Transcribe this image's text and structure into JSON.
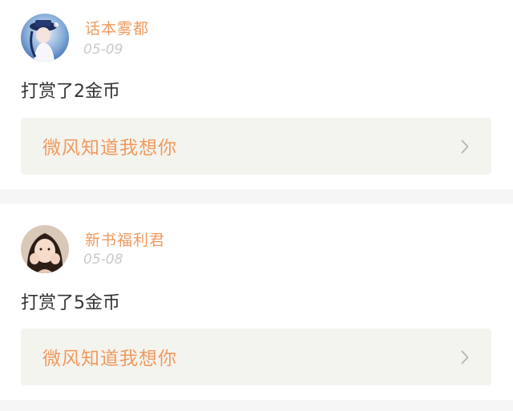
{
  "colors": {
    "accent": "#ef9a5f",
    "date_gray": "#c9c9c9",
    "text_dark": "#333333",
    "card_bg": "#f4f4ef",
    "separator": "#f6f6f6"
  },
  "feed": {
    "items": [
      {
        "username": "话本雾都",
        "date": "05-09",
        "action": "打赏了2金币",
        "book_title": "微风知道我想你",
        "avatar_icon": "avatar-anime-girl-icon",
        "chevron_icon": "chevron-right-icon"
      },
      {
        "username": "新书福利君",
        "date": "05-08",
        "action": "打赏了5金币",
        "book_title": "微风知道我想你",
        "avatar_icon": "avatar-photo-girl-icon",
        "chevron_icon": "chevron-right-icon"
      }
    ]
  }
}
